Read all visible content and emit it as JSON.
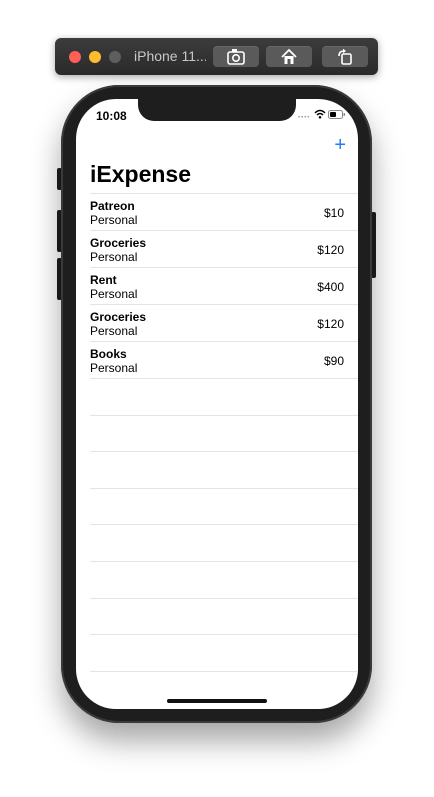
{
  "window": {
    "title": "iPhone 11...",
    "buttons": [
      "screenshot-icon",
      "home-icon",
      "rotate-icon"
    ]
  },
  "status_bar": {
    "time": "10:08"
  },
  "nav": {
    "add_label": "+",
    "title": "iExpense"
  },
  "expenses": [
    {
      "name": "Patreon",
      "type": "Personal",
      "amount": "$10"
    },
    {
      "name": "Groceries",
      "type": "Personal",
      "amount": "$120"
    },
    {
      "name": "Rent",
      "type": "Personal",
      "amount": "$400"
    },
    {
      "name": "Groceries",
      "type": "Personal",
      "amount": "$120"
    },
    {
      "name": "Books",
      "type": "Personal",
      "amount": "$90"
    }
  ],
  "colors": {
    "accent": "#1e7cf2",
    "separator": "#e4e4e6"
  }
}
